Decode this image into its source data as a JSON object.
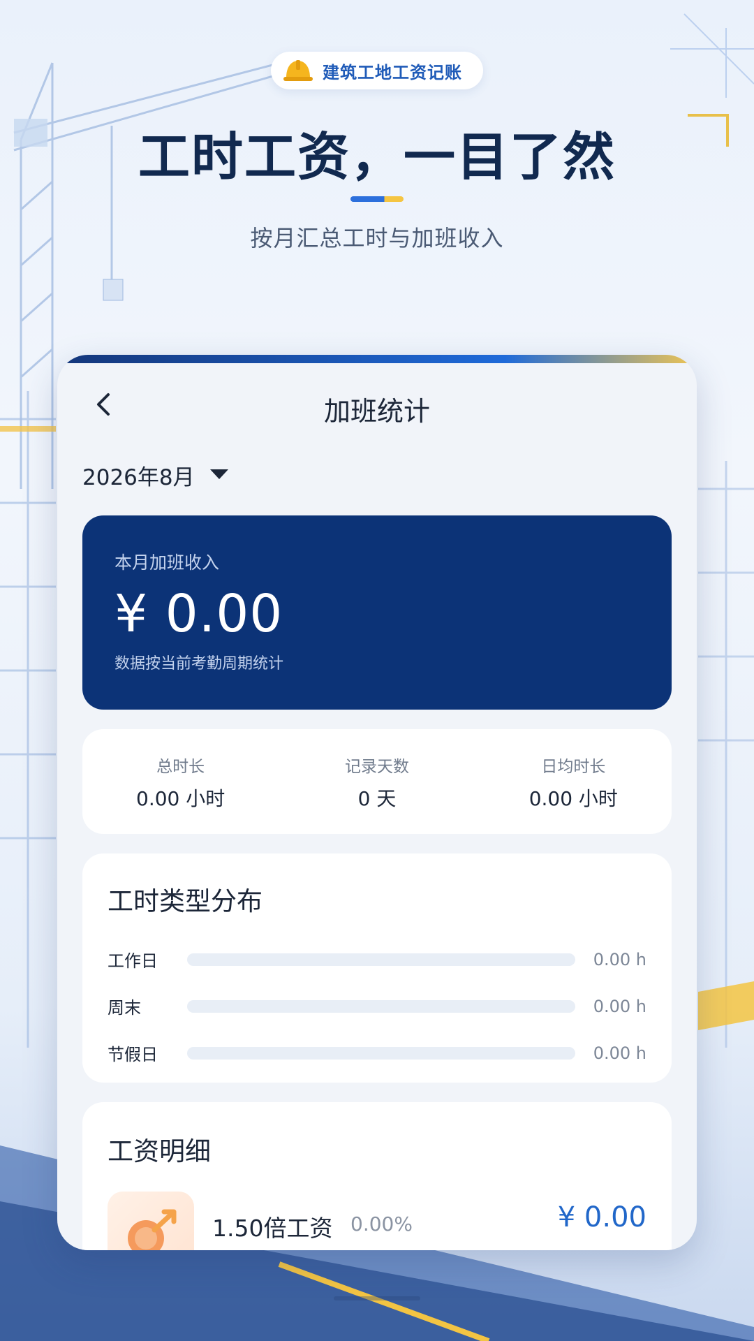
{
  "badge": {
    "icon": "hard-hat-icon",
    "label": "建筑工地工资记账"
  },
  "hero": {
    "title": "工时工资，一目了然",
    "subtitle": "按月汇总工时与加班收入"
  },
  "screen": {
    "nav": {
      "back_icon": "chevron-left-icon",
      "title": "加班统计"
    },
    "month_selector": {
      "value": "2026年8月",
      "icon": "caret-down-icon"
    },
    "income": {
      "label": "本月加班收入",
      "amount": "¥ 0.00",
      "note": "数据按当前考勤周期统计"
    },
    "stats": [
      {
        "label": "总时长",
        "value": "0.00 小时"
      },
      {
        "label": "记录天数",
        "value": "0 天"
      },
      {
        "label": "日均时长",
        "value": "0.00 小时"
      }
    ],
    "distribution": {
      "title": "工时类型分布",
      "rows": [
        {
          "name": "工作日",
          "value": "0.00 h",
          "fraction": 0
        },
        {
          "name": "周末",
          "value": "0.00 h",
          "fraction": 0
        },
        {
          "name": "节假日",
          "value": "0.00 h",
          "fraction": 0
        }
      ]
    },
    "wage_detail": {
      "title": "工资明细",
      "items": [
        {
          "name": "1.50倍工资",
          "percent": "0.00%",
          "amount": "¥ 0.00",
          "icon": "coin-growth-icon",
          "fraction": 0
        }
      ]
    }
  },
  "colors": {
    "accent": "#2c6fdc",
    "income_card": "#0c3377",
    "highlight": "#f5c542",
    "amount_blue": "#2167c9"
  }
}
